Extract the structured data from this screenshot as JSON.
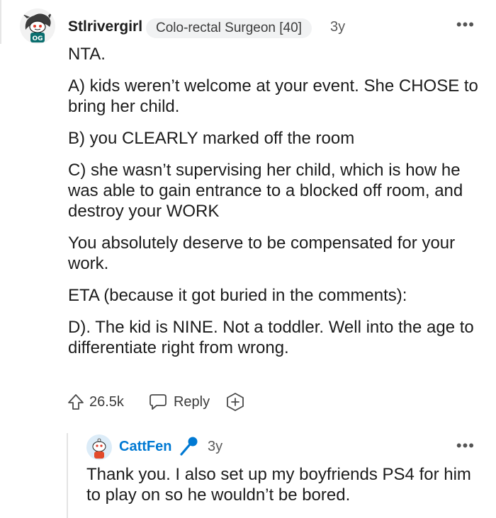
{
  "main_comment": {
    "author": "Stlrivergirl",
    "flair": "Colo-rectal Surgeon [40]",
    "age": "3y",
    "more": "•••",
    "paragraphs": [
      "NTA.",
      "A) kids weren’t welcome at your event. She CHOSE to bring her child.",
      "B) you CLEARLY marked off the room",
      "C) she wasn’t supervising her child, which is how he was able to gain entrance to a blocked off room, and destroy your WORK",
      "You absolutely deserve to be compensated for your work.",
      "ETA (because it got buried in the comments):",
      "D). The kid is NINE. Not a toddler. Well into the age to differentiate right from wrong."
    ],
    "upvotes": "26.5k",
    "reply_label": "Reply"
  },
  "reply_comment": {
    "author": "CattFen",
    "age": "3y",
    "more": "•••",
    "body": "Thank you. I also set up my boyfriends PS4 for him to play on so he wouldn’t be bored."
  },
  "icons": {
    "upvote": "upvote-arrow-icon",
    "reply": "speech-bubble-icon",
    "award": "award-plus-icon",
    "more": "ellipsis-icon",
    "mic": "microphone-icon"
  },
  "colors": {
    "reply_author": "#0079d3",
    "mic": "#0079d3",
    "flair_bg": "#f1f2f3"
  }
}
